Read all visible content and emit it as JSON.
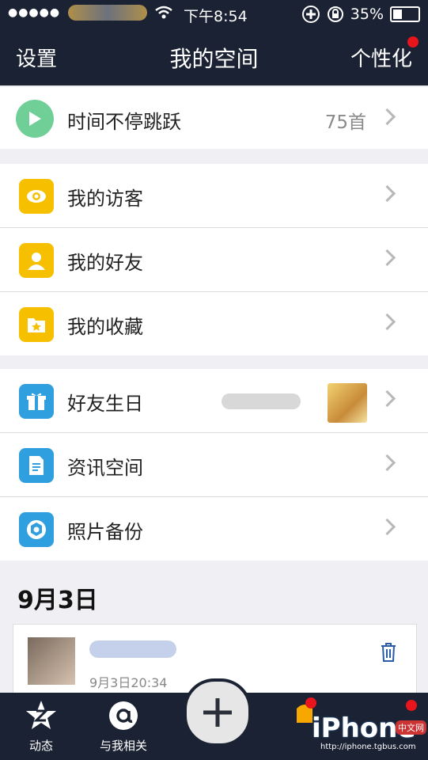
{
  "status_bar": {
    "signal": "●●●●●",
    "time": "下午8:54",
    "battery": "35%",
    "battery_level": 0.35
  },
  "nav": {
    "left": "设置",
    "title": "我的空间",
    "right": "个性化"
  },
  "music": {
    "label": "时间不停跳跃",
    "count": "75首"
  },
  "group1": [
    {
      "label": "我的访客",
      "icon": "eye-icon"
    },
    {
      "label": "我的好友",
      "icon": "person-icon"
    },
    {
      "label": "我的收藏",
      "icon": "star-folder-icon"
    }
  ],
  "group2": [
    {
      "label": "好友生日",
      "icon": "gift-icon"
    },
    {
      "label": "资讯空间",
      "icon": "document-icon"
    },
    {
      "label": "照片备份",
      "icon": "aperture-icon"
    }
  ],
  "feed": {
    "date": "9月3日",
    "post_time": "9月3日20:34"
  },
  "tabbar": {
    "tab1": "动态",
    "tab2": "与我相关"
  },
  "watermark": {
    "brand": "iPhone",
    "site": "http://iphone.tgbus.com",
    "badge": "中文网"
  },
  "colors": {
    "navbar": "#1b2233",
    "play_green": "#6fcf97",
    "icon_yellow": "#f6c000",
    "icon_blue": "#2f9fe0",
    "badge_red": "#e8151d"
  }
}
